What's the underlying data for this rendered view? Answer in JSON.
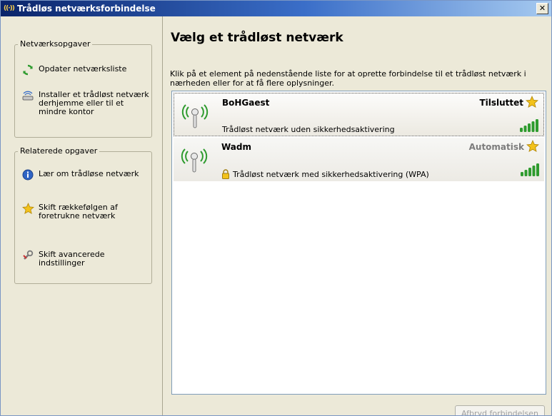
{
  "window": {
    "title": "Trådløs netværksforbindelse",
    "title_icon": "wireless-icon",
    "close_label": "✕"
  },
  "sidebar": {
    "network_tasks": {
      "title": "Netværksopgaver",
      "items": [
        {
          "label": "Opdater netværksliste",
          "icon": "refresh-icon"
        },
        {
          "label": "Installer et trådløst netværk derhjemme eller til et mindre kontor",
          "icon": "wireless-setup-icon"
        }
      ]
    },
    "related_tasks": {
      "title": "Relaterede opgaver",
      "items": [
        {
          "label": "Lær om trådløse netværk",
          "icon": "info-icon"
        },
        {
          "label": "Skift rækkefølgen af foretrukne netværk",
          "icon": "star-icon"
        },
        {
          "label": "Skift avancerede indstillinger",
          "icon": "settings-icon"
        }
      ]
    }
  },
  "main": {
    "heading": "Vælg et trådløst netværk",
    "instructions": "Klik på et element på nedenstående liste for at oprette forbindelse til et trådløst netværk i nærheden eller for at få flere oplysninger.",
    "networks": [
      {
        "name": "BoHGaest",
        "status": "Tilsluttet",
        "description": "Trådløst netværk uden sikkerhedsaktivering",
        "secured": false,
        "signal_bars": 5,
        "selected": true
      },
      {
        "name": "Wadm",
        "status": "Automatisk",
        "description": "Trådløst netværk med sikkerhedsaktivering (WPA)",
        "secured": true,
        "signal_bars": 5,
        "selected": false
      }
    ],
    "disconnect_button": "Afbryd forbindelsen"
  },
  "colors": {
    "titlebar_start": "#0a246a",
    "titlebar_end": "#a6caf0",
    "panel_background": "#ece9d8",
    "signal_green": "#2e9b2e",
    "star_yellow": "#f3c21a"
  }
}
